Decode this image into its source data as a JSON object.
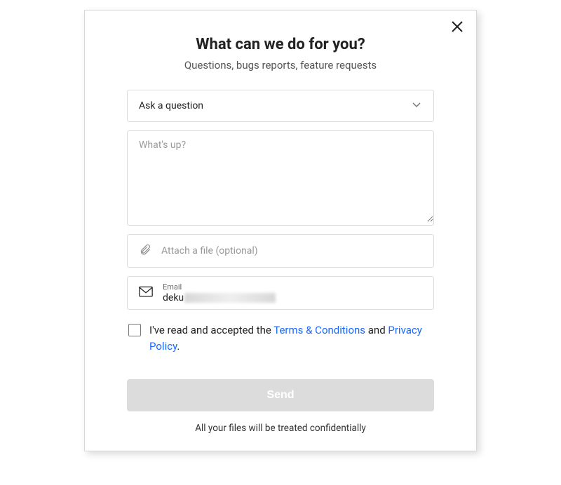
{
  "header": {
    "title": "What can we do for you?",
    "subtitle": "Questions, bugs reports, feature requests"
  },
  "topic_select": {
    "selected": "Ask a question"
  },
  "message": {
    "placeholder": "What's up?",
    "value": ""
  },
  "attach": {
    "label": "Attach a file (optional)"
  },
  "email": {
    "label": "Email",
    "value_visible": "deku"
  },
  "consent": {
    "prefix": "I've read and accepted the ",
    "terms_link": "Terms & Conditions",
    "middle": " and ",
    "privacy_link": "Privacy Policy",
    "suffix": "."
  },
  "send_button": {
    "label": "Send"
  },
  "footer": {
    "text": "All your files will be treated confidentially"
  }
}
